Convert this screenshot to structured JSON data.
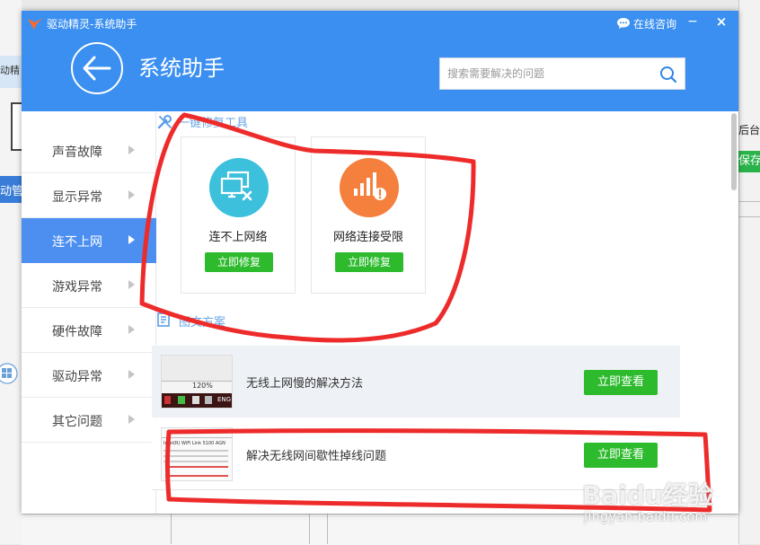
{
  "window": {
    "title": "驱动精灵-系统助手",
    "chat_label": "在线咨询",
    "minimize_glyph": "−",
    "close_glyph": "×"
  },
  "header": {
    "page_title": "系统助手",
    "search_placeholder": "搜索需要解决的问题"
  },
  "sidebar": {
    "items": [
      {
        "label": "声音故障",
        "active": false
      },
      {
        "label": "显示异常",
        "active": false
      },
      {
        "label": "连不上网",
        "active": true
      },
      {
        "label": "游戏异常",
        "active": false
      },
      {
        "label": "硬件故障",
        "active": false
      },
      {
        "label": "驱动异常",
        "active": false
      },
      {
        "label": "其它问题",
        "active": false
      }
    ]
  },
  "tools": {
    "section_title": "一键修复工具",
    "cards": [
      {
        "name": "连不上网络",
        "button": "立即修复",
        "icon": "network-disconnected-icon",
        "color": "#3cc0dc"
      },
      {
        "name": "网络连接受限",
        "button": "立即修复",
        "icon": "signal-limited-icon",
        "color": "#f5803d"
      }
    ]
  },
  "articles": {
    "section_title": "图文方案",
    "items": [
      {
        "title": "无线上网慢的解决方法",
        "button": "立即查看",
        "thumb_text": "120%",
        "thumb_taskbar_text": "ENG"
      },
      {
        "title": "解决无线网间歇性掉线问题",
        "button": "立即查看",
        "thumb_text": "Intel(R) WiFi Link 5100 AGN"
      }
    ]
  },
  "background": {
    "left_text_1": "动精",
    "left_text_2": "动管",
    "right_text": "后台管",
    "right_button": "保存"
  },
  "watermark": {
    "brand": "Baidu经验",
    "url": "jingyan.baidu.com"
  },
  "colors": {
    "header": "#3a8ff0",
    "sidebar_active": "#4c8ff1",
    "button_green": "#2dbb2d",
    "annotation_red": "#ee2b2b"
  }
}
